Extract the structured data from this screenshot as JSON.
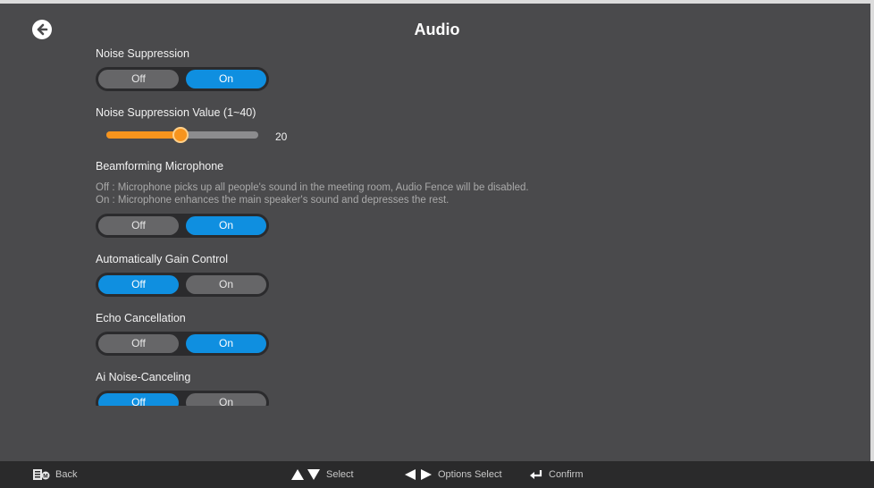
{
  "header": {
    "title": "Audio",
    "back_icon": "arrow-left-circle-icon"
  },
  "settings": [
    {
      "label": "Noise Suppression",
      "type": "toggle",
      "options": [
        "Off",
        "On"
      ],
      "selected": "On"
    },
    {
      "label": "Noise Suppression Value (1~40)",
      "type": "slider",
      "min": 1,
      "max": 40,
      "value": 20,
      "value_text": "20"
    },
    {
      "label": "Beamforming Microphone",
      "type": "toggle",
      "description_off": "Off : Microphone picks up all people's sound in the meeting room, Audio Fence will be disabled.",
      "description_on": "On : Microphone enhances the main speaker's sound and depresses the rest.",
      "options": [
        "Off",
        "On"
      ],
      "selected": "On"
    },
    {
      "label": "Automatically Gain Control",
      "type": "toggle",
      "options": [
        "Off",
        "On"
      ],
      "selected": "Off"
    },
    {
      "label": "Echo Cancellation",
      "type": "toggle",
      "options": [
        "Off",
        "On"
      ],
      "selected": "On"
    },
    {
      "label": "Ai Noise-Canceling",
      "type": "toggle",
      "options": [
        "Off",
        "On"
      ],
      "selected": "Off"
    }
  ],
  "footer": {
    "back": {
      "icon": "menu-key-icon",
      "label": "Back"
    },
    "select": {
      "icon": "up-down-arrows-icon",
      "label": "Select"
    },
    "options_select": {
      "icon": "left-right-arrows-icon",
      "label": "Options Select"
    },
    "confirm": {
      "icon": "enter-key-icon",
      "label": "Confirm"
    }
  },
  "colors": {
    "background": "#4a4a4c",
    "accent_blue": "#0f8fe0",
    "slider_orange": "#f7941d",
    "footer_bar": "#2a2a2b"
  }
}
